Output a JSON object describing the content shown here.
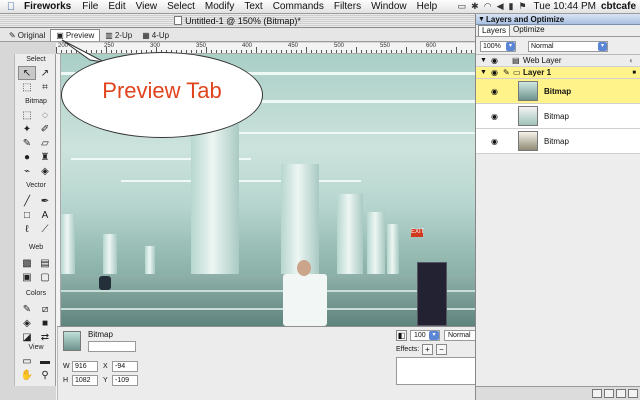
{
  "menubar": {
    "app_name": "Fireworks",
    "menus": [
      "File",
      "Edit",
      "View",
      "Select",
      "Modify",
      "Text",
      "Commands",
      "Filters",
      "Window",
      "Help"
    ],
    "clock": "Tue 10:44 PM",
    "user": "cbtcafe"
  },
  "document": {
    "title": "Untitled-1 @ 150% (Bitmap)*",
    "tabs": [
      "Original",
      "Preview",
      "2-Up",
      "4-Up"
    ],
    "active_tab": "Preview",
    "ruler_labels": [
      "200",
      "250",
      "300",
      "350",
      "400",
      "450",
      "500",
      "550",
      "600"
    ]
  },
  "callout": {
    "text": "Preview Tab"
  },
  "tools": {
    "sections": [
      "Select",
      "Bitmap",
      "Vector",
      "Web",
      "Colors",
      "View"
    ]
  },
  "property_inspector": {
    "object_type": "Bitmap",
    "w_label": "W",
    "w_value": "916",
    "h_label": "H",
    "h_value": "1082",
    "x_label": "X",
    "x_value": "-94",
    "y_label": "Y",
    "y_value": "-109",
    "opacity": "100",
    "blend_mode": "Normal",
    "effects_label": "Effects:"
  },
  "layers_panel": {
    "title": "Layers and Optimize",
    "tabs": [
      "Layers",
      "Optimize"
    ],
    "opacity": "100%",
    "blend_mode": "Normal",
    "rows": [
      {
        "name": "Web Layer",
        "kind": "web"
      },
      {
        "name": "Layer 1",
        "kind": "layer"
      },
      {
        "name": "Bitmap",
        "kind": "object",
        "selected": true
      },
      {
        "name": "Bitmap",
        "kind": "object",
        "selected": false
      },
      {
        "name": "Bitmap",
        "kind": "object",
        "selected": false
      }
    ]
  },
  "colors": {
    "accent": "#e0441d",
    "selection": "#fff389",
    "panel_header": "#a9c0e2"
  }
}
